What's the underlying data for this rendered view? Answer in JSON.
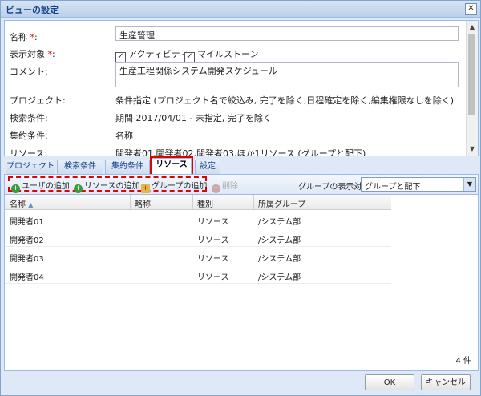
{
  "window": {
    "title": "ビューの設定"
  },
  "form": {
    "name_label": "名称",
    "name_required": "*",
    "name_label_colon": ":",
    "name_value": "生産管理",
    "display_label": "表示対象",
    "display_required": "*",
    "display_label_colon": ":",
    "display_options": [
      {
        "label": "アクティビティ",
        "checked": true
      },
      {
        "label": "マイルストーン",
        "checked": true
      }
    ],
    "comment_label": "コメント:",
    "comment_value": "生産工程関係システム開発スケジュール",
    "project_label": "プロジェクト:",
    "project_value": "条件指定 (プロジェクト名で絞込み, 完了を除く,日程確定を除く,編集権限なしを除く)",
    "search_label": "検索条件:",
    "search_value": "期間 2017/04/01 - 未指定, 完了を除く",
    "aggregate_label": "集約条件:",
    "aggregate_value": "名称",
    "resource_label": "リソース:",
    "resource_value": "開発者01,開発者02,開発者03,ほか1リソース (グループと配下)"
  },
  "tabs": [
    {
      "label": "プロジェクト",
      "active": false
    },
    {
      "label": "検索条件",
      "active": false
    },
    {
      "label": "集約条件",
      "active": false
    },
    {
      "label": "リソース",
      "active": true
    },
    {
      "label": "設定",
      "active": false
    }
  ],
  "toolbar": {
    "add_user": "ユーザの追加",
    "add_resource": "リソースの追加",
    "add_group": "グループの追加",
    "delete": "削除",
    "group_display_label": "グループの表示対象",
    "group_display_value": "グループと配下"
  },
  "grid": {
    "columns": [
      "名称",
      "略称",
      "種別",
      "所属グループ"
    ],
    "sort_indicator": "▲",
    "rows": [
      {
        "name": "開発者01",
        "abbr": "",
        "type": "リソース",
        "group": "/システム部"
      },
      {
        "name": "開発者02",
        "abbr": "",
        "type": "リソース",
        "group": "/システム部"
      },
      {
        "name": "開発者03",
        "abbr": "",
        "type": "リソース",
        "group": "/システム部"
      },
      {
        "name": "開発者04",
        "abbr": "",
        "type": "リソース",
        "group": "/システム部"
      }
    ],
    "count": "4 件"
  },
  "buttons": {
    "ok": "OK",
    "cancel": "キャンセル"
  }
}
